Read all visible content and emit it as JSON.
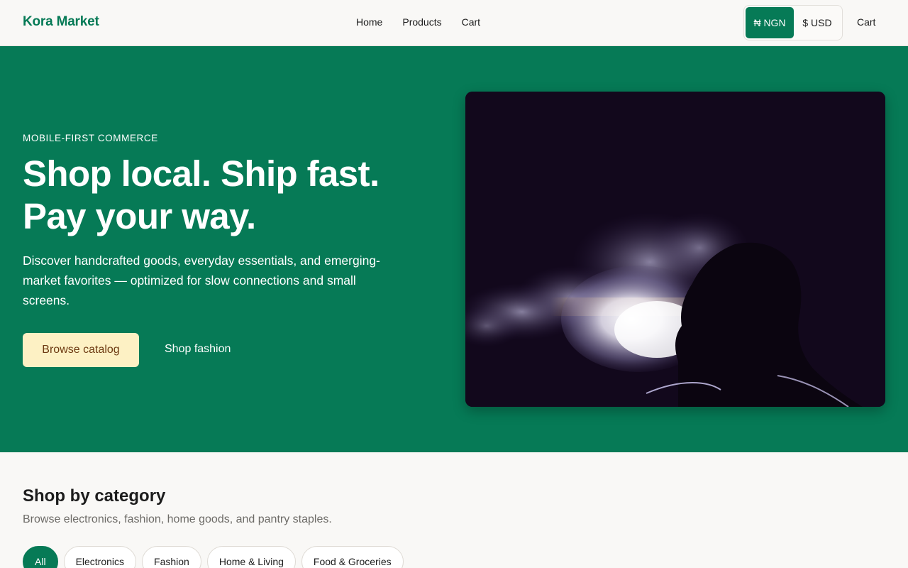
{
  "header": {
    "brand": "Kora Market",
    "nav": [
      "Home",
      "Products",
      "Cart"
    ],
    "currency": {
      "ngn": "₦ NGN",
      "usd": "$ USD",
      "selected": "NGN"
    },
    "cart": "Cart"
  },
  "hero": {
    "eyebrow": "MOBILE-FIRST COMMERCE",
    "headline_line1": "Shop local. Ship fast.",
    "headline_line2": "Pay your way.",
    "lede": "Discover handcrafted goods, everyday essentials, and emerging-market favorites — optimized for slow connections and small screens.",
    "primary_cta": "Browse catalog",
    "secondary_cta": "Shop fashion"
  },
  "category": {
    "title": "Shop by category",
    "subtitle": "Browse electronics, fashion, home goods, and pantry staples.",
    "chips": [
      "All",
      "Electronics",
      "Fashion",
      "Home & Living",
      "Food & Groceries"
    ],
    "active_chip": "All"
  },
  "colors": {
    "brand_green": "#067a56",
    "cta_cream": "#fdf1c4",
    "cta_text": "#6d3a12",
    "page_bg": "#f9f8f6"
  }
}
